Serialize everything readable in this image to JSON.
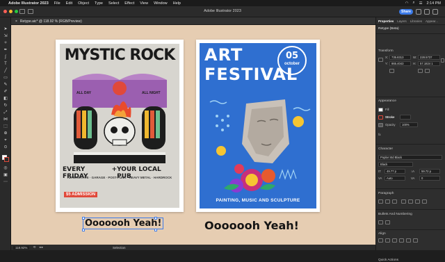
{
  "menubar": {
    "app_name": "Adobe Illustrator 2023",
    "items": [
      "File",
      "Edit",
      "Object",
      "Type",
      "Select",
      "Effect",
      "View",
      "Window",
      "Help"
    ],
    "clock": "2:14 PM"
  },
  "window": {
    "title": "Adobe Illustrator 2023",
    "share_label": "Share"
  },
  "document": {
    "tab_label": "Retype.aic* @ 118.92 % (RGB/Preview)",
    "close_glyph": "×"
  },
  "canvas": {
    "posters": {
      "rock": {
        "title": "MYSTIC ROCK",
        "left_tag": "ALL DAY",
        "right_tag": "ALL NIGHT",
        "line1_left": "EVERY FRIDAY",
        "line1_sep": "+",
        "line1_right": "YOUR LOCAL PUB",
        "genres": "ALTERNATIVE · GARAGE · POST-PUNK · HEAVY METAL · HARDROCK",
        "admission": "$5 ADMISSION"
      },
      "art": {
        "title_line1": "ART",
        "title_line2": "FESTIVAL",
        "date_day": "05",
        "date_month": "october",
        "subtitle": "PAINTING, MUSIC AND SCULPTURE"
      }
    },
    "caption_left": "Ooooooh Yeah!",
    "caption_right": "Ooooooh Yeah!"
  },
  "statusbar": {
    "zoom": "118.92%",
    "mode": "Selection"
  },
  "panel": {
    "tabs": [
      "Properties",
      "Layers",
      "Libraries",
      "Appear..."
    ],
    "selection_label": "Retype (Beta)",
    "transform": {
      "title": "Transform",
      "x_label": "X:",
      "x_value": "735.8313",
      "y_label": "Y:",
      "y_value": "865.4043",
      "w_label": "W:",
      "w_value": "228.5737",
      "h_label": "H:",
      "h_value": "57.1824 1"
    },
    "appearance": {
      "title": "Appearance",
      "fill_label": "Fill",
      "stroke_label": "Stroke",
      "opacity_label": "Opacity",
      "opacity_value": "100%",
      "fx_label": "fx."
    },
    "character": {
      "title": "Character",
      "font_family": "Poplar Std Black",
      "font_style": "Black",
      "size_value": "49.77 p",
      "leading_value": "59.72 p",
      "tracking_value": "Auto",
      "kerning_value": "0"
    },
    "sections": {
      "paragraph": "Paragraph",
      "bullets": "Bullets And Numbering",
      "align": "Align",
      "quick_actions": "Quick Actions"
    }
  },
  "colors": {
    "canvas_bg": "#e6cdb2",
    "ui_dark": "#2e2e2e",
    "share_blue": "#3b7ae8",
    "art_blue": "#2f6fd0",
    "rock_purple": "#9b5fb0",
    "stroke_red": "#e0493a"
  }
}
